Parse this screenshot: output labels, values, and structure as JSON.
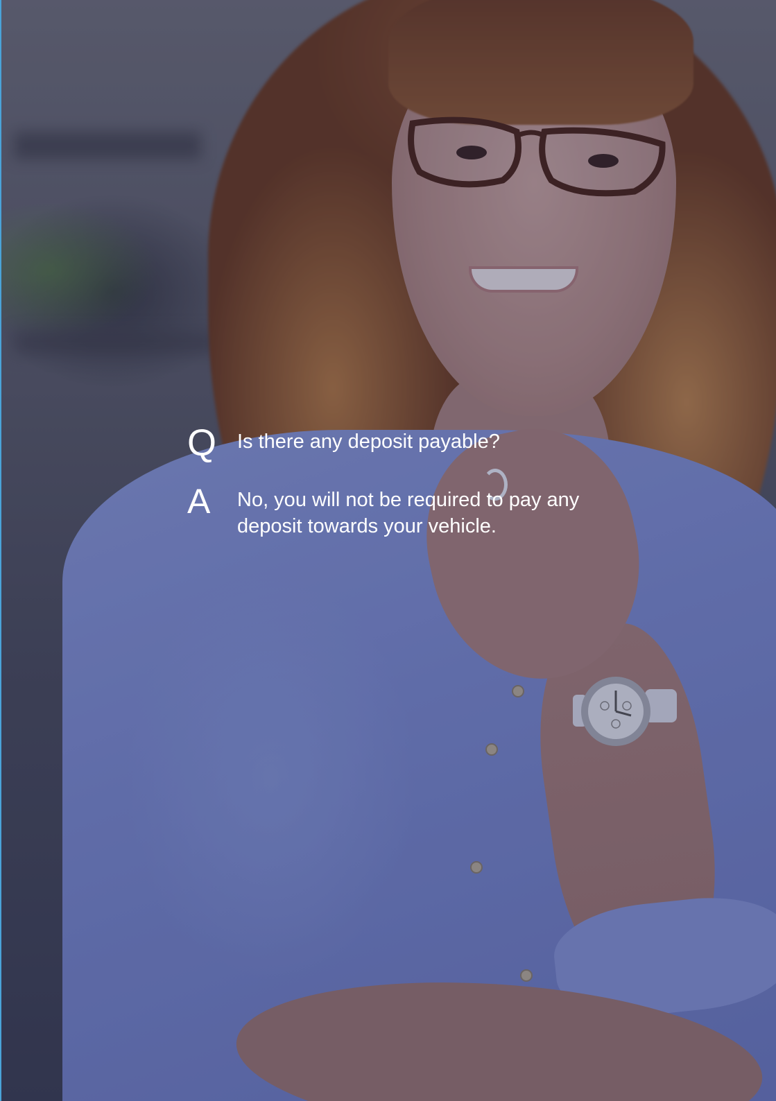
{
  "qa": {
    "question_letter": "Q",
    "question_text": "Is there any deposit payable?",
    "answer_letter": "A",
    "answer_text": "No, you will not be required to pay any deposit towards your vehicle."
  },
  "colors": {
    "text": "#ffffff",
    "accent_stripe": "#4aa3d8",
    "shirt": "#7b8bcf",
    "overlay": "#191e46"
  },
  "icons": {
    "background": "photo-of-woman-with-glasses"
  }
}
